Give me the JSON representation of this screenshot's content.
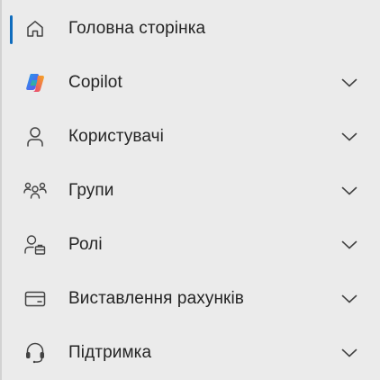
{
  "nav": {
    "accent_color": "#0f6cbd",
    "items": [
      {
        "label": "Головна сторінка",
        "icon": "home-icon",
        "active": true,
        "expandable": false
      },
      {
        "label": "Copilot",
        "icon": "copilot-icon",
        "active": false,
        "expandable": true
      },
      {
        "label": "Користувачі",
        "icon": "person-icon",
        "active": false,
        "expandable": true
      },
      {
        "label": "Групи",
        "icon": "people-team-icon",
        "active": false,
        "expandable": true
      },
      {
        "label": "Ролі",
        "icon": "person-role-icon",
        "active": false,
        "expandable": true
      },
      {
        "label": "Виставлення рахунків",
        "icon": "credit-card-icon",
        "active": false,
        "expandable": true
      },
      {
        "label": "Підтримка",
        "icon": "headset-icon",
        "active": false,
        "expandable": true
      }
    ]
  }
}
